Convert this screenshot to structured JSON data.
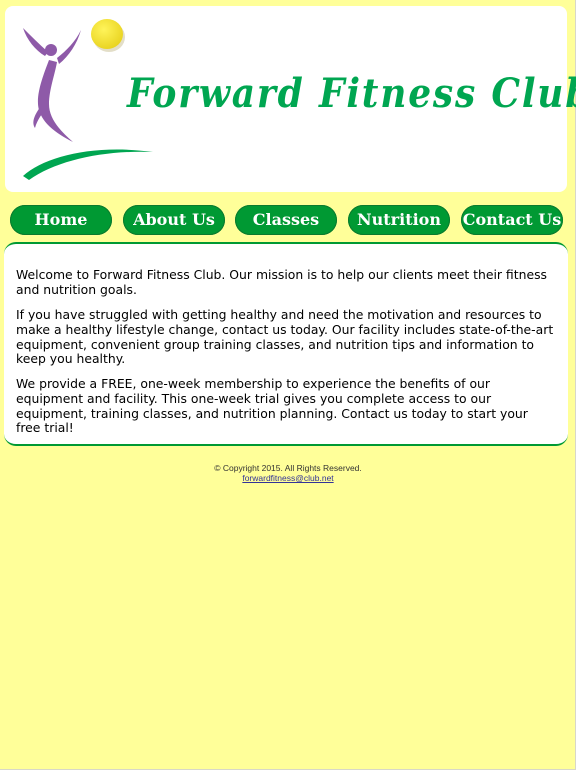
{
  "header": {
    "logo_text": "Forward Fitness Club"
  },
  "nav": {
    "items": [
      {
        "label": "Home"
      },
      {
        "label": "About Us"
      },
      {
        "label": "Classes"
      },
      {
        "label": "Nutrition"
      },
      {
        "label": "Contact Us"
      }
    ]
  },
  "main": {
    "paragraphs": [
      "Welcome to Forward Fitness Club. Our mission is to help our clients meet their fitness and nutrition goals.",
      "If you have struggled with getting healthy and need the motivation and resources to make a healthy lifestyle change, contact us today. Our facility includes state-of-the-art equipment, convenient group training classes, and nutrition tips and information to keep you healthy.",
      "We provide a FREE, one-week membership to experience the benefits of our equipment and facility. This one-week trial gives you complete access to our equipment, training classes, and nutrition planning. Contact us today to start your free trial!"
    ]
  },
  "footer": {
    "copyright": "© Copyright 2015. All Rights Reserved.",
    "email": "forwardfitness@club.net"
  },
  "colors": {
    "page_background": "#ffff99",
    "brand_green": "#009933",
    "logo_purple": "#8e5aa8",
    "sun_yellow": "#f2e030"
  }
}
